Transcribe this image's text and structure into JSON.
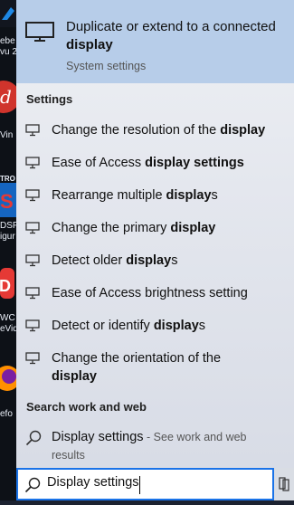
{
  "desktop": {
    "fragments": [
      "ebe",
      "vu 2",
      "Vin",
      "TRO",
      "DSP",
      "igur",
      "WC",
      "eVid",
      "efo"
    ]
  },
  "best_match": {
    "title_plain": "Duplicate or extend to a connected ",
    "title_bold": "display",
    "subtitle": "System settings",
    "icon": "monitor-icon"
  },
  "settings": {
    "heading": "Settings",
    "items": [
      {
        "pre": "Change the resolution of the ",
        "bold": "display",
        "post": ""
      },
      {
        "pre": "Ease of Access ",
        "bold": "display settings",
        "post": ""
      },
      {
        "pre": "Rearrange multiple ",
        "bold": "display",
        "post": "s"
      },
      {
        "pre": "Change the primary ",
        "bold": "display",
        "post": ""
      },
      {
        "pre": "Detect older ",
        "bold": "display",
        "post": "s"
      },
      {
        "pre": "Ease of Access brightness setting",
        "bold": "",
        "post": ""
      },
      {
        "pre": "Detect or identify ",
        "bold": "display",
        "post": "s"
      },
      {
        "pre": "Change the orientation of the ",
        "bold": "display",
        "post": ""
      }
    ]
  },
  "web": {
    "heading": "Search work and web",
    "item_text": "Display settings",
    "item_hint": " - See work and web results"
  },
  "search": {
    "value": "Display settings"
  },
  "colors": {
    "accent": "#1a73e8",
    "highlight": "#b7cde9"
  }
}
